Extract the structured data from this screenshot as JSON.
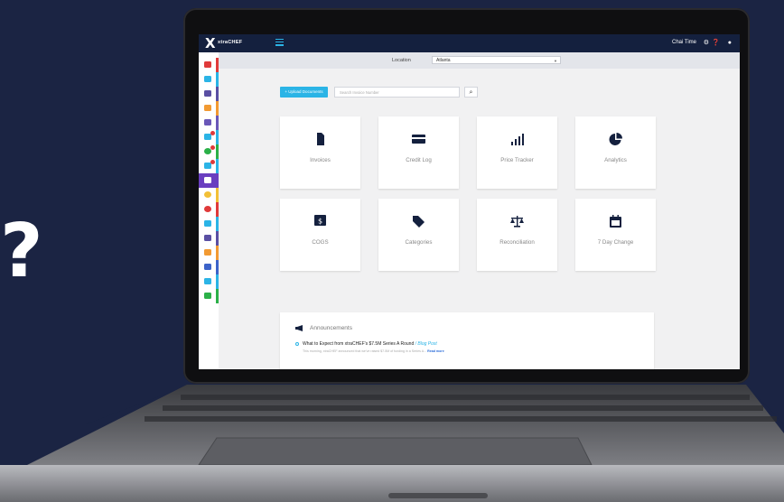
{
  "overlay": {
    "question_mark": "?"
  },
  "app": {
    "logo_mark": "X",
    "logo_text": "xtraCHEF",
    "user_name": "Chai Time",
    "top_icons": [
      "gear-icon",
      "help-icon",
      "user-icon"
    ]
  },
  "location": {
    "label": "Location",
    "value": "Atlanta"
  },
  "toolbar": {
    "upload_label": "+ Upload Documents",
    "search_placeholder": "Search Invoice Number"
  },
  "tiles": [
    {
      "label": "Invoices",
      "icon": "document-icon"
    },
    {
      "label": "Credit Log",
      "icon": "credit-card-icon"
    },
    {
      "label": "Price Tracker",
      "icon": "bar-chart-icon"
    },
    {
      "label": "Analytics",
      "icon": "pie-chart-icon"
    },
    {
      "label": "COGS",
      "icon": "money-icon"
    },
    {
      "label": "Categories",
      "icon": "tag-icon"
    },
    {
      "label": "Reconciliation",
      "icon": "scale-icon"
    },
    {
      "label": "7 Day Change",
      "icon": "calendar-icon"
    }
  ],
  "announcements": {
    "title": "Announcements",
    "item_title": "What to Expect from xtraCHEF's $7.5M Series A Round",
    "item_link": "/ Blog Post",
    "item_sub": "This morning, xtraCHEF announced that we've raised $7.5M of funding in a Series A...",
    "read_more": "Read more"
  },
  "colors": {
    "navy": "#14203e",
    "accent": "#2bb4e6",
    "background": "#1b2443"
  }
}
